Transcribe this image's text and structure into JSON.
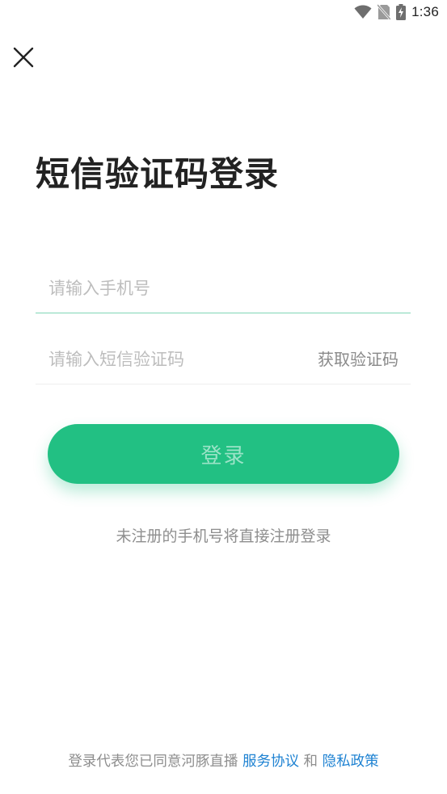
{
  "status_bar": {
    "time": "1:36",
    "icons": [
      "wifi-icon",
      "no-sim-icon",
      "battery-charging-icon"
    ]
  },
  "header": {
    "close_icon": "close-icon"
  },
  "main": {
    "title": "短信验证码登录",
    "phone_field": {
      "value": "",
      "placeholder": "请输入手机号"
    },
    "code_field": {
      "value": "",
      "placeholder": "请输入短信验证码",
      "get_code_label": "获取验证码"
    },
    "login_button": "登录",
    "hint": "未注册的手机号将直接注册登录"
  },
  "footer": {
    "prefix": "登录代表您已同意河豚直播",
    "service_link": "服务协议",
    "conjunction": "和",
    "privacy_link": "隐私政策"
  },
  "colors": {
    "accent": "#22c083",
    "link": "#1e82d2",
    "focus_underline": "#7fd6b6"
  }
}
